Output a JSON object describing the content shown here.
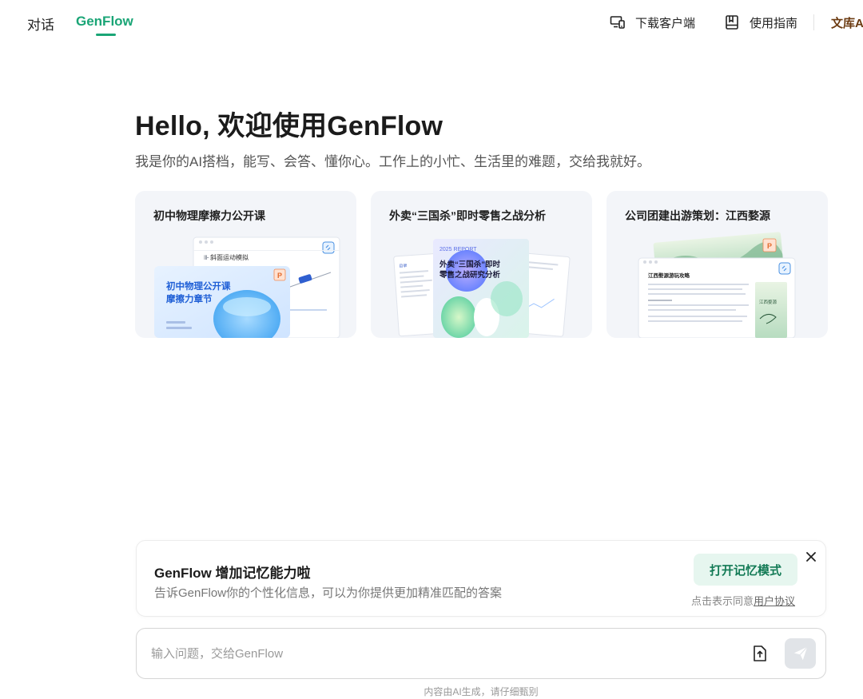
{
  "nav": {
    "tabs": [
      {
        "label": "对话",
        "active": false
      },
      {
        "label": "GenFlow",
        "active": true
      }
    ],
    "actions": [
      {
        "label": "下载客户端",
        "icon": "monitor-phone-icon"
      },
      {
        "label": "使用指南",
        "icon": "book-icon"
      }
    ],
    "wenku_label": "文库A"
  },
  "hero": {
    "title": "Hello, 欢迎使用GenFlow",
    "subtitle": "我是你的AI搭档，能写、会答、懂你心。工作上的小忙、生活里的难题，交给我就好。"
  },
  "cards": [
    {
      "title": "初中物理摩擦力公开课",
      "preview_heading": "初中物理公开课",
      "preview_subheading": "摩擦力章节",
      "preview_doc_label": "斜面运动模拟",
      "preview_badge": "P"
    },
    {
      "title": "外卖“三国杀”即时零售之战分析",
      "preview_tag": "2025 REPORT",
      "preview_heading": "外卖“三国杀”即时",
      "preview_subheading": "零售之战研究分析",
      "preview_doc_label": "目录"
    },
    {
      "title": "公司团建出游策划：江西婺源",
      "preview_heading": "江西婺源游玩攻略",
      "preview_side_label": "江西婺源",
      "preview_badge": "P"
    }
  ],
  "memory": {
    "title": "GenFlow 增加记忆能力啦",
    "description": "告诉GenFlow你的个性化信息，可以为你提供更加精准匹配的答案",
    "button_label": "打开记忆模式",
    "consent_prefix": "点击表示同意",
    "consent_link": "用户协议"
  },
  "input": {
    "placeholder": "输入问题，交给GenFlow",
    "value": ""
  },
  "disclaimer": "内容由AI生成，请仔细甄别",
  "colors": {
    "accent": "#1aa576",
    "memory_button_bg": "#e6f6ef",
    "card_bg": "#f3f5f9"
  }
}
